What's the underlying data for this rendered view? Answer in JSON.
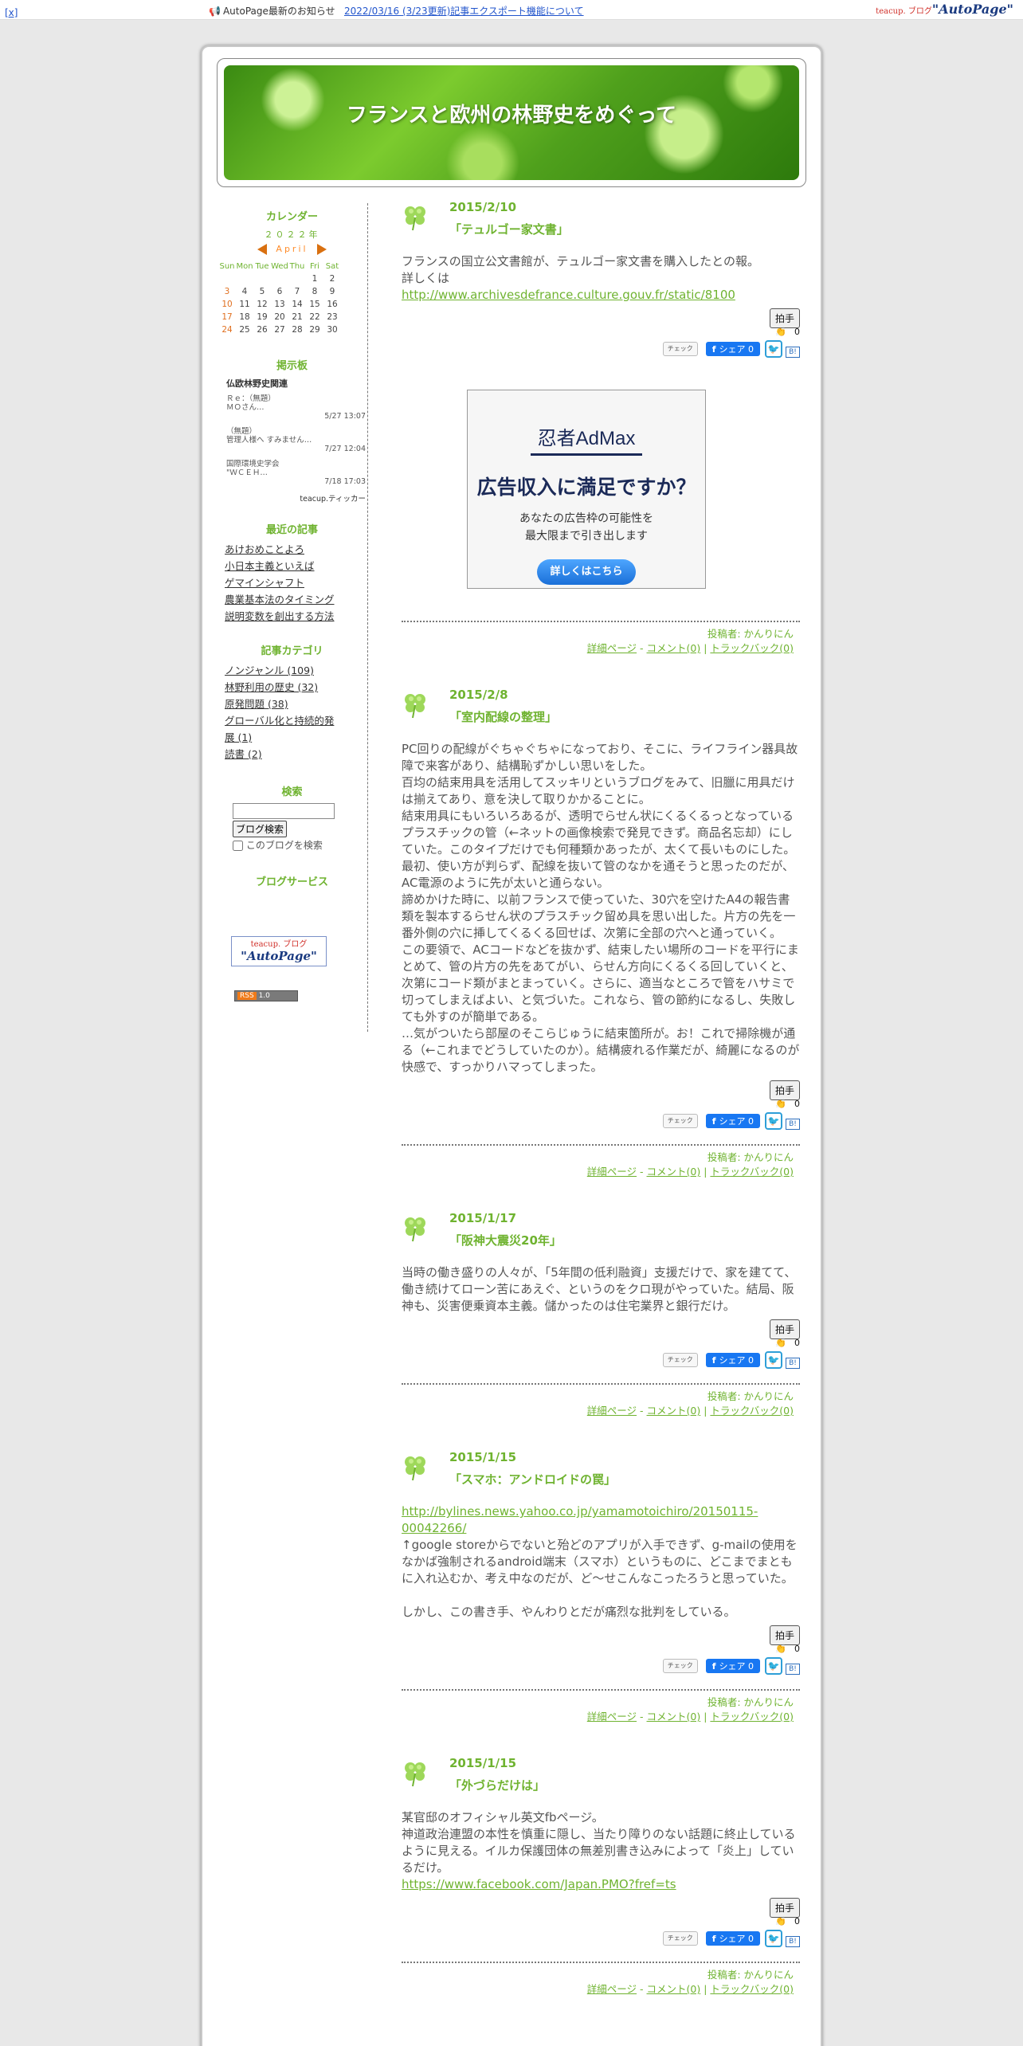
{
  "topbar": {
    "close_label": "[x]",
    "notice_label": "AutoPage最新のお知らせ",
    "notice_link": "2022/03/16 (3/23更新)記事エクスポート機能について",
    "brand_small": "teacup. ブログ",
    "brand_main": "\"AutoPage\""
  },
  "blog": {
    "title": "フランスと欧州の林野史をめぐって"
  },
  "calendar": {
    "heading": "カレンダー",
    "year_label": "２０２２年",
    "month_label": "April",
    "weekdays": [
      "Sun",
      "Mon",
      "Tue",
      "Wed",
      "Thu",
      "Fri",
      "Sat"
    ],
    "weeks": [
      [
        "",
        "",
        "",
        "",
        "",
        "1",
        "2"
      ],
      [
        "3",
        "4",
        "5",
        "6",
        "7",
        "8",
        "9"
      ],
      [
        "10",
        "11",
        "12",
        "13",
        "14",
        "15",
        "16"
      ],
      [
        "17",
        "18",
        "19",
        "20",
        "21",
        "22",
        "23"
      ],
      [
        "24",
        "25",
        "26",
        "27",
        "28",
        "29",
        "30"
      ]
    ]
  },
  "board": {
    "heading": "掲示板",
    "title": "仏欧林野史関連",
    "entries": [
      {
        "text": "Ｒｅ：（無題）\nＭＯさん…",
        "date": "5/27 13:07"
      },
      {
        "text": "（無題）\n管理人様へ すみません…",
        "date": "7/27 12:04"
      },
      {
        "text": "国際環境史学会\n\"ＷＣＥＨ…",
        "date": "7/18 17:03"
      }
    ],
    "footer": "teacup.ティッカー"
  },
  "recent": {
    "heading": "最近の記事",
    "items": [
      "あけおめことよろ",
      "小日本主義といえば",
      "ゲマインシャフト",
      "農業基本法のタイミング",
      "説明変数を創出する方法"
    ]
  },
  "categories": {
    "heading": "記事カテゴリ",
    "items": [
      "ノンジャンル (109)",
      "林野利用の歴史 (32)",
      "原発問題 (38)",
      "グローバル化と持続的発展 (1)",
      "読書 (2)"
    ]
  },
  "search": {
    "heading": "検索",
    "button_label": "ブログ検索",
    "option_label": "このブログを検索",
    "value": ""
  },
  "service": {
    "heading": "ブログサービス",
    "badge_small": "teacup. ブログ",
    "badge_main": "\"AutoPage\"",
    "rss_tag": "RSS",
    "rss_ver": "1.0"
  },
  "ad": {
    "brand": "忍者AdMax",
    "headline": "広告収入に満足ですか？",
    "sub1": "あなたの広告枠の可能性を",
    "sub2": "最大限まで引き出します",
    "cta": "詳しくはこちら"
  },
  "post_ui": {
    "clap_label": "拍手",
    "clap_count": "0",
    "check_label": "チェック",
    "fb_label": "シェア 0",
    "author_label": "投稿者: かんりにん",
    "detail_label": "詳細ページ",
    "comment_label": "コメント(0)",
    "trackback_label": "トラックバック(0)"
  },
  "posts": [
    {
      "date": "2015/2/10",
      "title": "「テュルゴー家文書」",
      "body": [
        "フランスの国立公文書館が、テュルゴー家文書を購入したとの報。",
        "詳しくは"
      ],
      "link": "http://www.archivesdefrance.culture.gouv.fr/static/8100"
    },
    {
      "date": "2015/2/8",
      "title": "「室内配線の整理」",
      "body": [
        "PC回りの配線がぐちゃぐちゃになっており、そこに、ライフライン器具故障で来客があり、結構恥ずかしい思いをした。",
        "百均の結束用具を活用してスッキリというブログをみて、旧臘に用具だけは揃えてあり、意を決して取りかかることに。",
        "結束用具にもいろいろあるが、透明でらせん状にくるくるっとなっているプラスチックの管（←ネットの画像検索で発見できず。商品名忘却）にしていた。このタイプだけでも何種類かあったが、太くて長いものにした。",
        "最初、使い方が判らず、配線を抜いて管のなかを通そうと思ったのだが、AC電源のように先が太いと通らない。",
        "諦めかけた時に、以前フランスで使っていた、30穴を空けたA4の報告書類を製本するらせん状のプラスチック留め具を思い出した。片方の先を一番外側の穴に挿してくるくる回せば、次第に全部の穴へと通っていく。",
        "この要領で、ACコードなどを抜かず、結束したい場所のコードを平行にまとめて、管の片方の先をあてがい、らせん方向にくるくる回していくと、次第にコード類がまとまっていく。さらに、適当なところで管をハサミで切ってしまえばよい、と気づいた。これなら、管の節約になるし、失敗しても外すのが簡単である。",
        "…気がついたら部屋のそこらじゅうに結束箇所が。お！これで掃除機が通る（←これまでどうしていたのか）。結構疲れる作業だが、綺麗になるのが快感で、すっかりハマってしまった。"
      ],
      "link": ""
    },
    {
      "date": "2015/1/17",
      "title": "「阪神大震災20年」",
      "body": [
        "当時の働き盛りの人々が、「5年間の低利融資」支援だけで、家を建てて、働き続けてローン苦にあえぐ、というのをクロ現がやっていた。結局、阪神も、災害便乗資本主義。儲かったのは住宅業界と銀行だけ。"
      ],
      "link": ""
    },
    {
      "date": "2015/1/15",
      "title": "「スマホ：アンドロイドの罠」",
      "link_top": "http://bylines.news.yahoo.co.jp/yamamotoichiro/20150115-00042266/",
      "body": [
        "↑google storeからでないと殆どのアプリが入手できず、g-mailの使用をなかば強制されるandroid端末（スマホ）というものに、どこまでまともに入れ込むか、考え中なのだが、ど～せこんなこったろうと思っていた。",
        " ",
        "しかし、この書き手、やんわりとだが痛烈な批判をしている。"
      ],
      "link": ""
    },
    {
      "date": "2015/1/15",
      "title": "「外づらだけは」",
      "body": [
        "某官邸のオフィシャル英文fbページ。",
        "神道政治連盟の本性を慎重に隠し、当たり障りのない話題に終止しているように見える。イルカ保護団体の無差別書き込みによって「炎上」しているだけ。"
      ],
      "link": "https://www.facebook.com/Japan.PMO?fref=ts"
    }
  ]
}
